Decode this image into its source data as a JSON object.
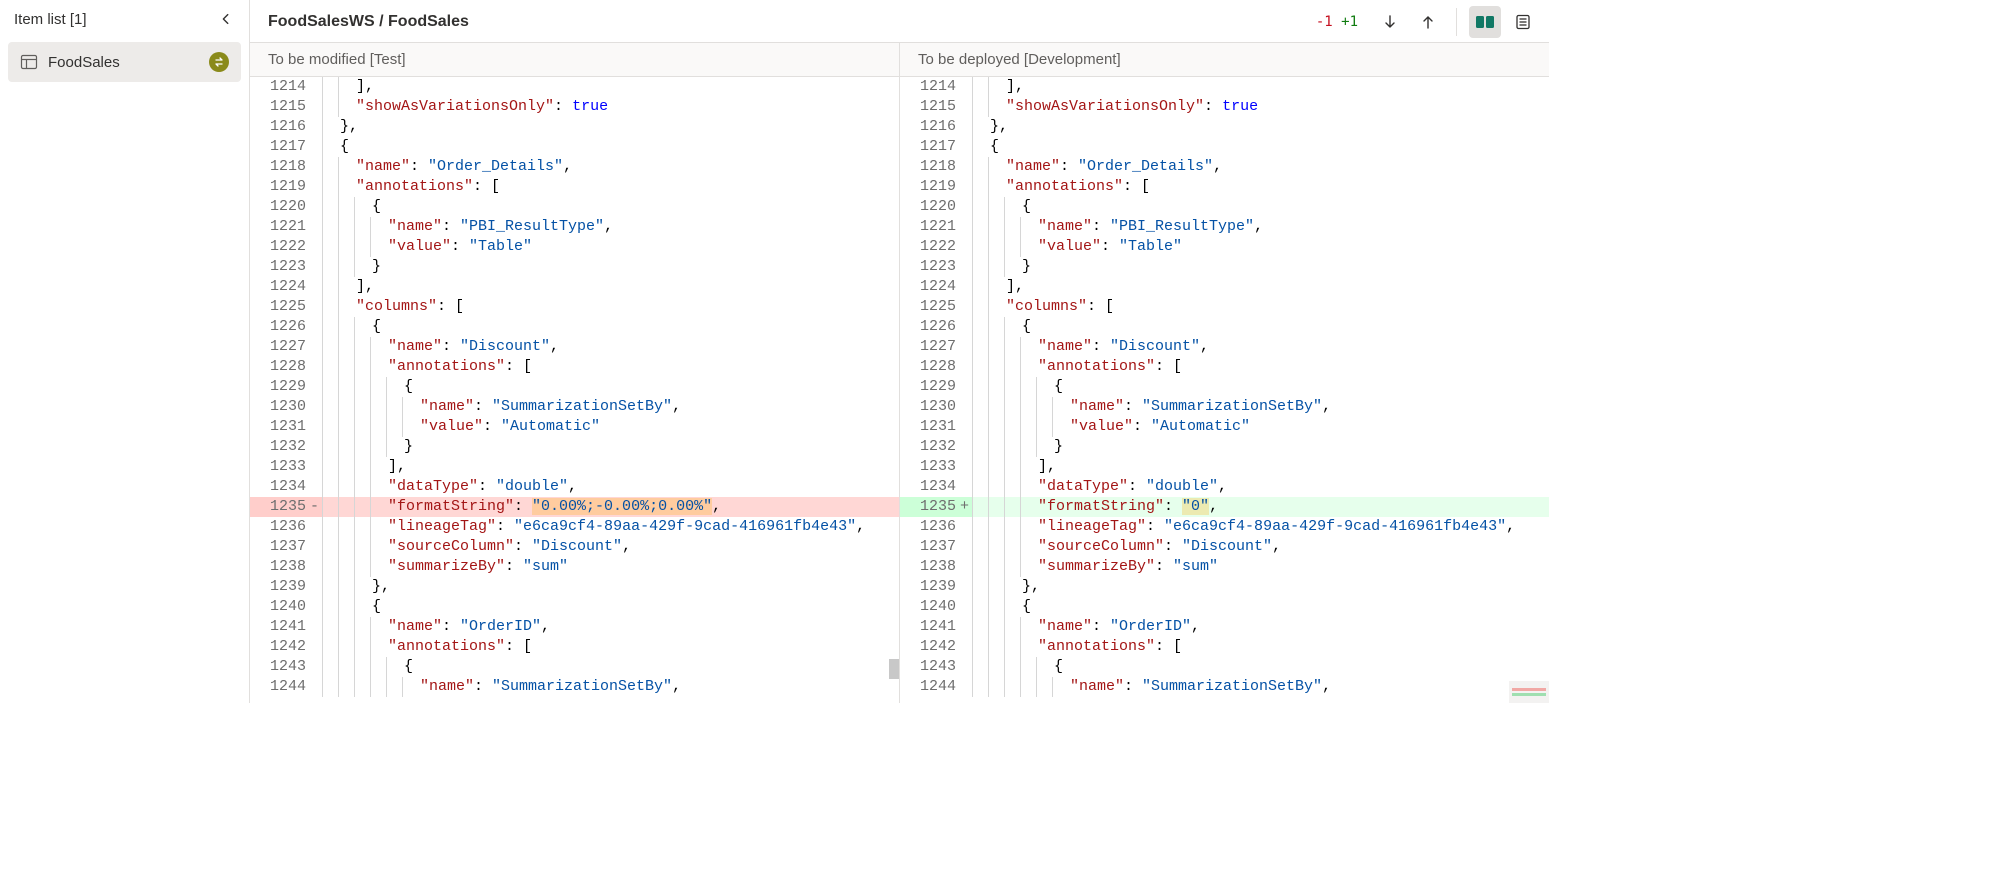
{
  "sidebar": {
    "title": "Item list [1]",
    "items": [
      {
        "label": "FoodSales",
        "icon": "dataset-icon",
        "status": "modified"
      }
    ]
  },
  "header": {
    "breadcrumb": "FoodSalesWS / FoodSales",
    "removed_count": "-1",
    "added_count": "+1"
  },
  "panes": {
    "left_title": "To be modified [Test]",
    "right_title": "To be deployed [Development]"
  },
  "code": {
    "left": [
      {
        "n": 1214,
        "indent": 2,
        "tokens": [
          {
            "t": "],",
            "c": "punc"
          }
        ]
      },
      {
        "n": 1215,
        "indent": 2,
        "tokens": [
          {
            "t": "\"showAsVariationsOnly\"",
            "c": "key"
          },
          {
            "t": ": ",
            "c": "punc"
          },
          {
            "t": "true",
            "c": "kw"
          }
        ]
      },
      {
        "n": 1216,
        "indent": 1,
        "tokens": [
          {
            "t": "},",
            "c": "punc"
          }
        ]
      },
      {
        "n": 1217,
        "indent": 1,
        "tokens": [
          {
            "t": "{",
            "c": "punc"
          }
        ]
      },
      {
        "n": 1218,
        "indent": 2,
        "tokens": [
          {
            "t": "\"name\"",
            "c": "key"
          },
          {
            "t": ": ",
            "c": "punc"
          },
          {
            "t": "\"Order_Details\"",
            "c": "str"
          },
          {
            "t": ",",
            "c": "punc"
          }
        ]
      },
      {
        "n": 1219,
        "indent": 2,
        "tokens": [
          {
            "t": "\"annotations\"",
            "c": "key"
          },
          {
            "t": ": [",
            "c": "punc"
          }
        ]
      },
      {
        "n": 1220,
        "indent": 3,
        "tokens": [
          {
            "t": "{",
            "c": "punc"
          }
        ]
      },
      {
        "n": 1221,
        "indent": 4,
        "tokens": [
          {
            "t": "\"name\"",
            "c": "key"
          },
          {
            "t": ": ",
            "c": "punc"
          },
          {
            "t": "\"PBI_ResultType\"",
            "c": "str"
          },
          {
            "t": ",",
            "c": "punc"
          }
        ]
      },
      {
        "n": 1222,
        "indent": 4,
        "tokens": [
          {
            "t": "\"value\"",
            "c": "key"
          },
          {
            "t": ": ",
            "c": "punc"
          },
          {
            "t": "\"Table\"",
            "c": "str"
          }
        ]
      },
      {
        "n": 1223,
        "indent": 3,
        "tokens": [
          {
            "t": "}",
            "c": "punc"
          }
        ]
      },
      {
        "n": 1224,
        "indent": 2,
        "tokens": [
          {
            "t": "],",
            "c": "punc"
          }
        ]
      },
      {
        "n": 1225,
        "indent": 2,
        "tokens": [
          {
            "t": "\"columns\"",
            "c": "key"
          },
          {
            "t": ": [",
            "c": "punc"
          }
        ]
      },
      {
        "n": 1226,
        "indent": 3,
        "tokens": [
          {
            "t": "{",
            "c": "punc"
          }
        ]
      },
      {
        "n": 1227,
        "indent": 4,
        "tokens": [
          {
            "t": "\"name\"",
            "c": "key"
          },
          {
            "t": ": ",
            "c": "punc"
          },
          {
            "t": "\"Discount\"",
            "c": "str"
          },
          {
            "t": ",",
            "c": "punc"
          }
        ]
      },
      {
        "n": 1228,
        "indent": 4,
        "tokens": [
          {
            "t": "\"annotations\"",
            "c": "key"
          },
          {
            "t": ": [",
            "c": "punc"
          }
        ]
      },
      {
        "n": 1229,
        "indent": 5,
        "tokens": [
          {
            "t": "{",
            "c": "punc"
          }
        ]
      },
      {
        "n": 1230,
        "indent": 6,
        "tokens": [
          {
            "t": "\"name\"",
            "c": "key"
          },
          {
            "t": ": ",
            "c": "punc"
          },
          {
            "t": "\"SummarizationSetBy\"",
            "c": "str"
          },
          {
            "t": ",",
            "c": "punc"
          }
        ]
      },
      {
        "n": 1231,
        "indent": 6,
        "tokens": [
          {
            "t": "\"value\"",
            "c": "key"
          },
          {
            "t": ": ",
            "c": "punc"
          },
          {
            "t": "\"Automatic\"",
            "c": "str"
          }
        ]
      },
      {
        "n": 1232,
        "indent": 5,
        "tokens": [
          {
            "t": "}",
            "c": "punc"
          }
        ]
      },
      {
        "n": 1233,
        "indent": 4,
        "tokens": [
          {
            "t": "],",
            "c": "punc"
          }
        ]
      },
      {
        "n": 1234,
        "indent": 4,
        "tokens": [
          {
            "t": "\"dataType\"",
            "c": "key"
          },
          {
            "t": ": ",
            "c": "punc"
          },
          {
            "t": "\"double\"",
            "c": "str"
          },
          {
            "t": ",",
            "c": "punc"
          }
        ]
      },
      {
        "n": 1235,
        "indent": 4,
        "status": "removed",
        "marker": "-",
        "tokens": [
          {
            "t": "\"formatString\"",
            "c": "key"
          },
          {
            "t": ": ",
            "c": "punc"
          },
          {
            "t": "\"0.00%;-0.00%;0.00%\"",
            "c": "str",
            "hl": true
          },
          {
            "t": ",",
            "c": "punc"
          }
        ]
      },
      {
        "n": 1236,
        "indent": 4,
        "tokens": [
          {
            "t": "\"lineageTag\"",
            "c": "key"
          },
          {
            "t": ": ",
            "c": "punc"
          },
          {
            "t": "\"e6ca9cf4-89aa-429f-9cad-416961fb4e43\"",
            "c": "str"
          },
          {
            "t": ",",
            "c": "punc"
          }
        ]
      },
      {
        "n": 1237,
        "indent": 4,
        "tokens": [
          {
            "t": "\"sourceColumn\"",
            "c": "key"
          },
          {
            "t": ": ",
            "c": "punc"
          },
          {
            "t": "\"Discount\"",
            "c": "str"
          },
          {
            "t": ",",
            "c": "punc"
          }
        ]
      },
      {
        "n": 1238,
        "indent": 4,
        "tokens": [
          {
            "t": "\"summarizeBy\"",
            "c": "key"
          },
          {
            "t": ": ",
            "c": "punc"
          },
          {
            "t": "\"sum\"",
            "c": "str"
          }
        ]
      },
      {
        "n": 1239,
        "indent": 3,
        "tokens": [
          {
            "t": "},",
            "c": "punc"
          }
        ]
      },
      {
        "n": 1240,
        "indent": 3,
        "tokens": [
          {
            "t": "{",
            "c": "punc"
          }
        ]
      },
      {
        "n": 1241,
        "indent": 4,
        "tokens": [
          {
            "t": "\"name\"",
            "c": "key"
          },
          {
            "t": ": ",
            "c": "punc"
          },
          {
            "t": "\"OrderID\"",
            "c": "str"
          },
          {
            "t": ",",
            "c": "punc"
          }
        ]
      },
      {
        "n": 1242,
        "indent": 4,
        "tokens": [
          {
            "t": "\"annotations\"",
            "c": "key"
          },
          {
            "t": ": [",
            "c": "punc"
          }
        ]
      },
      {
        "n": 1243,
        "indent": 5,
        "tokens": [
          {
            "t": "{",
            "c": "punc"
          }
        ]
      },
      {
        "n": 1244,
        "indent": 6,
        "tokens": [
          {
            "t": "\"name\"",
            "c": "key"
          },
          {
            "t": ": ",
            "c": "punc"
          },
          {
            "t": "\"SummarizationSetBy\"",
            "c": "str"
          },
          {
            "t": ",",
            "c": "punc"
          }
        ]
      }
    ],
    "right": [
      {
        "n": 1214,
        "indent": 2,
        "tokens": [
          {
            "t": "],",
            "c": "punc"
          }
        ]
      },
      {
        "n": 1215,
        "indent": 2,
        "tokens": [
          {
            "t": "\"showAsVariationsOnly\"",
            "c": "key"
          },
          {
            "t": ": ",
            "c": "punc"
          },
          {
            "t": "true",
            "c": "kw"
          }
        ]
      },
      {
        "n": 1216,
        "indent": 1,
        "tokens": [
          {
            "t": "},",
            "c": "punc"
          }
        ]
      },
      {
        "n": 1217,
        "indent": 1,
        "tokens": [
          {
            "t": "{",
            "c": "punc"
          }
        ]
      },
      {
        "n": 1218,
        "indent": 2,
        "tokens": [
          {
            "t": "\"name\"",
            "c": "key"
          },
          {
            "t": ": ",
            "c": "punc"
          },
          {
            "t": "\"Order_Details\"",
            "c": "str"
          },
          {
            "t": ",",
            "c": "punc"
          }
        ]
      },
      {
        "n": 1219,
        "indent": 2,
        "tokens": [
          {
            "t": "\"annotations\"",
            "c": "key"
          },
          {
            "t": ": [",
            "c": "punc"
          }
        ]
      },
      {
        "n": 1220,
        "indent": 3,
        "tokens": [
          {
            "t": "{",
            "c": "punc"
          }
        ]
      },
      {
        "n": 1221,
        "indent": 4,
        "tokens": [
          {
            "t": "\"name\"",
            "c": "key"
          },
          {
            "t": ": ",
            "c": "punc"
          },
          {
            "t": "\"PBI_ResultType\"",
            "c": "str"
          },
          {
            "t": ",",
            "c": "punc"
          }
        ]
      },
      {
        "n": 1222,
        "indent": 4,
        "tokens": [
          {
            "t": "\"value\"",
            "c": "key"
          },
          {
            "t": ": ",
            "c": "punc"
          },
          {
            "t": "\"Table\"",
            "c": "str"
          }
        ]
      },
      {
        "n": 1223,
        "indent": 3,
        "tokens": [
          {
            "t": "}",
            "c": "punc"
          }
        ]
      },
      {
        "n": 1224,
        "indent": 2,
        "tokens": [
          {
            "t": "],",
            "c": "punc"
          }
        ]
      },
      {
        "n": 1225,
        "indent": 2,
        "tokens": [
          {
            "t": "\"columns\"",
            "c": "key"
          },
          {
            "t": ": [",
            "c": "punc"
          }
        ]
      },
      {
        "n": 1226,
        "indent": 3,
        "tokens": [
          {
            "t": "{",
            "c": "punc"
          }
        ]
      },
      {
        "n": 1227,
        "indent": 4,
        "tokens": [
          {
            "t": "\"name\"",
            "c": "key"
          },
          {
            "t": ": ",
            "c": "punc"
          },
          {
            "t": "\"Discount\"",
            "c": "str"
          },
          {
            "t": ",",
            "c": "punc"
          }
        ]
      },
      {
        "n": 1228,
        "indent": 4,
        "tokens": [
          {
            "t": "\"annotations\"",
            "c": "key"
          },
          {
            "t": ": [",
            "c": "punc"
          }
        ]
      },
      {
        "n": 1229,
        "indent": 5,
        "tokens": [
          {
            "t": "{",
            "c": "punc"
          }
        ]
      },
      {
        "n": 1230,
        "indent": 6,
        "tokens": [
          {
            "t": "\"name\"",
            "c": "key"
          },
          {
            "t": ": ",
            "c": "punc"
          },
          {
            "t": "\"SummarizationSetBy\"",
            "c": "str"
          },
          {
            "t": ",",
            "c": "punc"
          }
        ]
      },
      {
        "n": 1231,
        "indent": 6,
        "tokens": [
          {
            "t": "\"value\"",
            "c": "key"
          },
          {
            "t": ": ",
            "c": "punc"
          },
          {
            "t": "\"Automatic\"",
            "c": "str"
          }
        ]
      },
      {
        "n": 1232,
        "indent": 5,
        "tokens": [
          {
            "t": "}",
            "c": "punc"
          }
        ]
      },
      {
        "n": 1233,
        "indent": 4,
        "tokens": [
          {
            "t": "],",
            "c": "punc"
          }
        ]
      },
      {
        "n": 1234,
        "indent": 4,
        "tokens": [
          {
            "t": "\"dataType\"",
            "c": "key"
          },
          {
            "t": ": ",
            "c": "punc"
          },
          {
            "t": "\"double\"",
            "c": "str"
          },
          {
            "t": ",",
            "c": "punc"
          }
        ]
      },
      {
        "n": 1235,
        "indent": 4,
        "status": "added",
        "marker": "+",
        "tokens": [
          {
            "t": "\"formatString\"",
            "c": "key"
          },
          {
            "t": ": ",
            "c": "punc"
          },
          {
            "t": "\"0\"",
            "c": "str",
            "hl": true
          },
          {
            "t": ",",
            "c": "punc"
          }
        ]
      },
      {
        "n": 1236,
        "indent": 4,
        "tokens": [
          {
            "t": "\"lineageTag\"",
            "c": "key"
          },
          {
            "t": ": ",
            "c": "punc"
          },
          {
            "t": "\"e6ca9cf4-89aa-429f-9cad-416961fb4e43\"",
            "c": "str"
          },
          {
            "t": ",",
            "c": "punc"
          }
        ]
      },
      {
        "n": 1237,
        "indent": 4,
        "tokens": [
          {
            "t": "\"sourceColumn\"",
            "c": "key"
          },
          {
            "t": ": ",
            "c": "punc"
          },
          {
            "t": "\"Discount\"",
            "c": "str"
          },
          {
            "t": ",",
            "c": "punc"
          }
        ]
      },
      {
        "n": 1238,
        "indent": 4,
        "tokens": [
          {
            "t": "\"summarizeBy\"",
            "c": "key"
          },
          {
            "t": ": ",
            "c": "punc"
          },
          {
            "t": "\"sum\"",
            "c": "str"
          }
        ]
      },
      {
        "n": 1239,
        "indent": 3,
        "tokens": [
          {
            "t": "},",
            "c": "punc"
          }
        ]
      },
      {
        "n": 1240,
        "indent": 3,
        "tokens": [
          {
            "t": "{",
            "c": "punc"
          }
        ]
      },
      {
        "n": 1241,
        "indent": 4,
        "tokens": [
          {
            "t": "\"name\"",
            "c": "key"
          },
          {
            "t": ": ",
            "c": "punc"
          },
          {
            "t": "\"OrderID\"",
            "c": "str"
          },
          {
            "t": ",",
            "c": "punc"
          }
        ]
      },
      {
        "n": 1242,
        "indent": 4,
        "tokens": [
          {
            "t": "\"annotations\"",
            "c": "key"
          },
          {
            "t": ": [",
            "c": "punc"
          }
        ]
      },
      {
        "n": 1243,
        "indent": 5,
        "tokens": [
          {
            "t": "{",
            "c": "punc"
          }
        ]
      },
      {
        "n": 1244,
        "indent": 6,
        "tokens": [
          {
            "t": "\"name\"",
            "c": "key"
          },
          {
            "t": ": ",
            "c": "punc"
          },
          {
            "t": "\"SummarizationSetBy\"",
            "c": "str"
          },
          {
            "t": ",",
            "c": "punc"
          }
        ]
      }
    ]
  }
}
